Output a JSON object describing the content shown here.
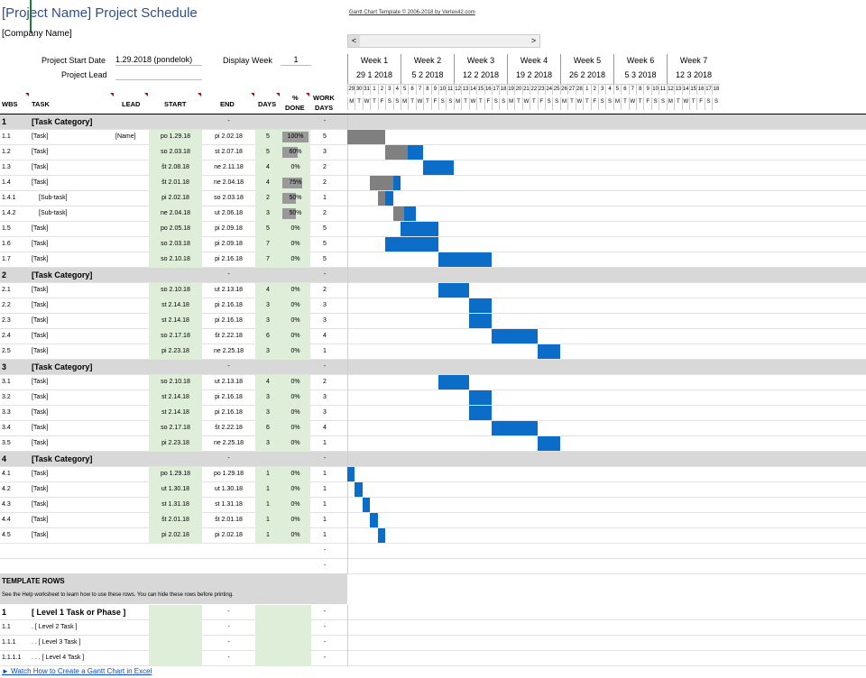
{
  "header": {
    "title": "[Project Name] Project Schedule",
    "company": "[Company Name]",
    "template_note": "Gantt Chart Template © 2006-2018 by Vertex42.com",
    "start_label": "Project Start Date",
    "start_value": "1.29.2018 (pondelok)",
    "lead_label": "Project Lead",
    "display_week_label": "Display Week",
    "display_week_value": "1",
    "scroll_left": "<",
    "scroll_right": ">"
  },
  "timeline": {
    "weeks": [
      {
        "label": "Week 1",
        "date": "29 1 2018"
      },
      {
        "label": "Week 2",
        "date": "5 2 2018"
      },
      {
        "label": "Week 3",
        "date": "12 2 2018"
      },
      {
        "label": "Week 4",
        "date": "19 2 2018"
      },
      {
        "label": "Week 5",
        "date": "26 2 2018"
      },
      {
        "label": "Week 6",
        "date": "5 3 2018"
      },
      {
        "label": "Week 7",
        "date": "12 3 2018"
      }
    ],
    "days": [
      "29",
      "30",
      "31",
      "1",
      "2",
      "3",
      "4",
      "5",
      "6",
      "7",
      "8",
      "9",
      "10",
      "11",
      "12",
      "13",
      "14",
      "15",
      "16",
      "17",
      "18",
      "19",
      "20",
      "21",
      "22",
      "23",
      "24",
      "25",
      "26",
      "27",
      "28",
      "1",
      "2",
      "3",
      "4",
      "5",
      "6",
      "7",
      "8",
      "9",
      "10",
      "11",
      "12",
      "13",
      "14",
      "15",
      "16",
      "17",
      "18"
    ],
    "dow": [
      "M",
      "T",
      "W",
      "T",
      "F",
      "S",
      "S",
      "M",
      "T",
      "W",
      "T",
      "F",
      "S",
      "S",
      "M",
      "T",
      "W",
      "T",
      "F",
      "S",
      "S",
      "M",
      "T",
      "W",
      "T",
      "F",
      "S",
      "S",
      "M",
      "T",
      "W",
      "T",
      "F",
      "S",
      "S",
      "M",
      "T",
      "W",
      "T",
      "F",
      "S",
      "S",
      "M",
      "T",
      "W",
      "T",
      "F",
      "S",
      "S"
    ]
  },
  "columns": {
    "wbs": "WBS",
    "task": "TASK",
    "lead": "LEAD",
    "start": "START",
    "end": "END",
    "days": "DAYS",
    "done_1": "%",
    "done_2": "DONE",
    "work_1": "WORK",
    "work_2": "DAYS"
  },
  "rows": [
    {
      "type": "cat",
      "wbs": "1",
      "task": "[Task Category]",
      "end": "-",
      "work": "-"
    },
    {
      "wbs": "1.1",
      "task": "[Task]",
      "lead": "[Name]",
      "start": "po 1.29.18",
      "end": "pi 2.02.18",
      "days": "5",
      "done": "100%",
      "pct": 1,
      "work": "5",
      "s": 0,
      "d": 5
    },
    {
      "wbs": "1.2",
      "task": "[Task]",
      "start": "so 2.03.18",
      "end": "st 2.07.18",
      "days": "5",
      "done": "60%",
      "pct": 0.6,
      "work": "3",
      "s": 5,
      "d": 5
    },
    {
      "wbs": "1.3",
      "task": "[Task]",
      "start": "št 2.08.18",
      "end": "ne 2.11.18",
      "days": "4",
      "done": "0%",
      "pct": 0,
      "work": "2",
      "s": 10,
      "d": 4
    },
    {
      "wbs": "1.4",
      "task": "[Task]",
      "start": "št 2.01.18",
      "end": "ne 2.04.18",
      "days": "4",
      "done": "75%",
      "pct": 0.75,
      "work": "2",
      "s": 3,
      "d": 4
    },
    {
      "wbs": "1.4.1",
      "task": "[Sub-task]",
      "indent": 1,
      "start": "pi 2.02.18",
      "end": "so 2.03.18",
      "days": "2",
      "done": "50%",
      "pct": 0.5,
      "work": "1",
      "s": 4,
      "d": 2
    },
    {
      "wbs": "1.4.2",
      "task": "[Sub-task]",
      "indent": 1,
      "start": "ne 2.04.18",
      "end": "ut 2.06.18",
      "days": "3",
      "done": "50%",
      "pct": 0.5,
      "work": "2",
      "s": 6,
      "d": 3
    },
    {
      "wbs": "1.5",
      "task": "[Task]",
      "start": "po 2.05.18",
      "end": "pi 2.09.18",
      "days": "5",
      "done": "0%",
      "pct": 0,
      "work": "5",
      "s": 7,
      "d": 5
    },
    {
      "wbs": "1.6",
      "task": "[Task]",
      "start": "so 2.03.18",
      "end": "pi 2.09.18",
      "days": "7",
      "done": "0%",
      "pct": 0,
      "work": "5",
      "s": 5,
      "d": 7
    },
    {
      "wbs": "1.7",
      "task": "[Task]",
      "start": "so 2.10.18",
      "end": "pi 2.16.18",
      "days": "7",
      "done": "0%",
      "pct": 0,
      "work": "5",
      "s": 12,
      "d": 7
    },
    {
      "type": "cat",
      "wbs": "2",
      "task": "[Task Category]",
      "end": "-",
      "work": "-"
    },
    {
      "wbs": "2.1",
      "task": "[Task]",
      "start": "so 2.10.18",
      "end": "ut 2.13.18",
      "days": "4",
      "done": "0%",
      "pct": 0,
      "work": "2",
      "s": 12,
      "d": 4
    },
    {
      "wbs": "2.2",
      "task": "[Task]",
      "start": "st 2.14.18",
      "end": "pi 2.16.18",
      "days": "3",
      "done": "0%",
      "pct": 0,
      "work": "3",
      "s": 16,
      "d": 3
    },
    {
      "wbs": "2.3",
      "task": "[Task]",
      "start": "st 2.14.18",
      "end": "pi 2.16.18",
      "days": "3",
      "done": "0%",
      "pct": 0,
      "work": "3",
      "s": 16,
      "d": 3
    },
    {
      "wbs": "2.4",
      "task": "[Task]",
      "start": "so 2.17.18",
      "end": "št 2.22.18",
      "days": "6",
      "done": "0%",
      "pct": 0,
      "work": "4",
      "s": 19,
      "d": 6
    },
    {
      "wbs": "2.5",
      "task": "[Task]",
      "start": "pi 2.23.18",
      "end": "ne 2.25.18",
      "days": "3",
      "done": "0%",
      "pct": 0,
      "work": "1",
      "s": 25,
      "d": 3
    },
    {
      "type": "cat",
      "wbs": "3",
      "task": "[Task Category]",
      "end": "-",
      "work": "-"
    },
    {
      "wbs": "3.1",
      "task": "[Task]",
      "start": "so 2.10.18",
      "end": "ut 2.13.18",
      "days": "4",
      "done": "0%",
      "pct": 0,
      "work": "2",
      "s": 12,
      "d": 4
    },
    {
      "wbs": "3.2",
      "task": "[Task]",
      "start": "st 2.14.18",
      "end": "pi 2.16.18",
      "days": "3",
      "done": "0%",
      "pct": 0,
      "work": "3",
      "s": 16,
      "d": 3
    },
    {
      "wbs": "3.3",
      "task": "[Task]",
      "start": "st 2.14.18",
      "end": "pi 2.16.18",
      "days": "3",
      "done": "0%",
      "pct": 0,
      "work": "3",
      "s": 16,
      "d": 3
    },
    {
      "wbs": "3.4",
      "task": "[Task]",
      "start": "so 2.17.18",
      "end": "št 2.22.18",
      "days": "6",
      "done": "0%",
      "pct": 0,
      "work": "4",
      "s": 19,
      "d": 6
    },
    {
      "wbs": "3.5",
      "task": "[Task]",
      "start": "pi 2.23.18",
      "end": "ne 2.25.18",
      "days": "3",
      "done": "0%",
      "pct": 0,
      "work": "1",
      "s": 25,
      "d": 3
    },
    {
      "type": "cat",
      "wbs": "4",
      "task": "[Task Category]",
      "end": "-",
      "work": "-"
    },
    {
      "wbs": "4.1",
      "task": "[Task]",
      "start": "po 1.29.18",
      "end": "po 1.29.18",
      "days": "1",
      "done": "0%",
      "pct": 0,
      "work": "1",
      "s": 0,
      "d": 1
    },
    {
      "wbs": "4.2",
      "task": "[Task]",
      "start": "ut 1.30.18",
      "end": "ut 1.30.18",
      "days": "1",
      "done": "0%",
      "pct": 0,
      "work": "1",
      "s": 1,
      "d": 1
    },
    {
      "wbs": "4.3",
      "task": "[Task]",
      "start": "st 1.31.18",
      "end": "st 1.31.18",
      "days": "1",
      "done": "0%",
      "pct": 0,
      "work": "1",
      "s": 2,
      "d": 1
    },
    {
      "wbs": "4.4",
      "task": "[Task]",
      "start": "št 2.01.18",
      "end": "št 2.01.18",
      "days": "1",
      "done": "0%",
      "pct": 0,
      "work": "1",
      "s": 3,
      "d": 1
    },
    {
      "wbs": "4.5",
      "task": "[Task]",
      "start": "pi 2.02.18",
      "end": "pi 2.02.18",
      "days": "1",
      "done": "0%",
      "pct": 0,
      "work": "1",
      "s": 4,
      "d": 1
    },
    {
      "type": "blank",
      "work": "-"
    },
    {
      "type": "blank",
      "work": "-"
    }
  ],
  "template": {
    "title": "TEMPLATE ROWS",
    "help": "See the Help worksheet to learn how to use these rows. You can hide these rows before printing.",
    "rows": [
      {
        "wbs": "1",
        "task": "[ Level 1 Task or Phase ]",
        "end": "-",
        "work": "-",
        "level": 1
      },
      {
        "wbs": "1.1",
        "task": ". [ Level 2 Task ]",
        "end": "-",
        "work": "-",
        "level": 2
      },
      {
        "wbs": "1.1.1",
        "task": ". . [ Level 3 Task ]",
        "end": "-",
        "work": "-",
        "level": 3
      },
      {
        "wbs": "1.1.1.1",
        "task": ". . . [ Level 4 Task ]",
        "end": "-",
        "work": "-",
        "level": 4
      }
    ]
  },
  "footer": {
    "link": "► Watch How to Create a Gantt Chart in Excel"
  },
  "colors": {
    "progress": "#808080",
    "remaining": "#0b6dc8",
    "category": "#d8d8d8",
    "input": "#dfeed9"
  }
}
